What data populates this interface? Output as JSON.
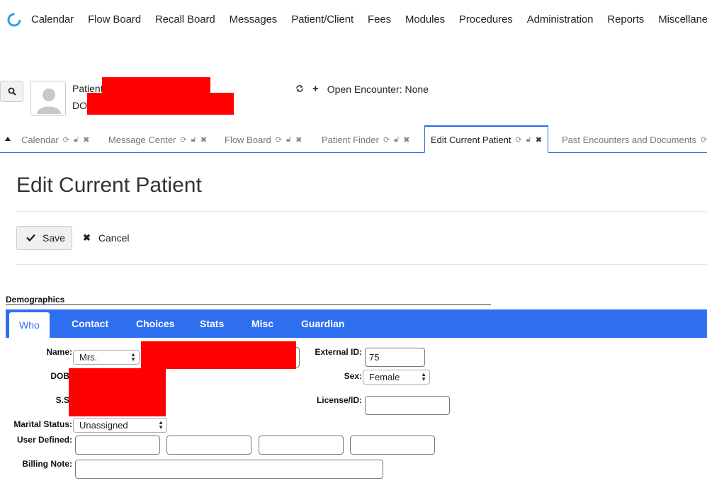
{
  "menu": {
    "items": [
      "Calendar",
      "Flow Board",
      "Recall Board",
      "Messages",
      "Patient/Client",
      "Fees",
      "Modules",
      "Procedures",
      "Administration",
      "Reports",
      "Miscellaneous"
    ]
  },
  "patient": {
    "patient_label": "Patient",
    "dob_label": "DO"
  },
  "encounter": {
    "text": "Open Encounter: None"
  },
  "tabs": [
    {
      "label": "Calendar"
    },
    {
      "label": "Message Center"
    },
    {
      "label": "Flow Board"
    },
    {
      "label": "Patient Finder"
    },
    {
      "label": "Edit Current Patient"
    },
    {
      "label": "Past Encounters and Documents"
    }
  ],
  "page": {
    "title": "Edit Current Patient",
    "save_label": "Save",
    "cancel_label": "Cancel"
  },
  "demographics": {
    "title": "Demographics",
    "tabs": [
      "Who",
      "Contact",
      "Choices",
      "Stats",
      "Misc",
      "Guardian"
    ],
    "active_tab": "Who",
    "labels": {
      "name": "Name:",
      "dob": "DOB",
      "ss": "S.S",
      "marital": "Marital Status:",
      "user_defined": "User Defined:",
      "billing_note": "Billing Note:",
      "external_id": "External ID:",
      "sex": "Sex:",
      "license": "License/ID:"
    },
    "values": {
      "title_select": "Mrs.",
      "marital_select": "Unassigned",
      "external_id": "75",
      "sex_select": "Female",
      "license": "",
      "user_defined": [
        "",
        "",
        "",
        ""
      ],
      "billing_note": ""
    }
  },
  "colors": {
    "accent": "#2e6ff2",
    "redaction": "#ff0000"
  }
}
